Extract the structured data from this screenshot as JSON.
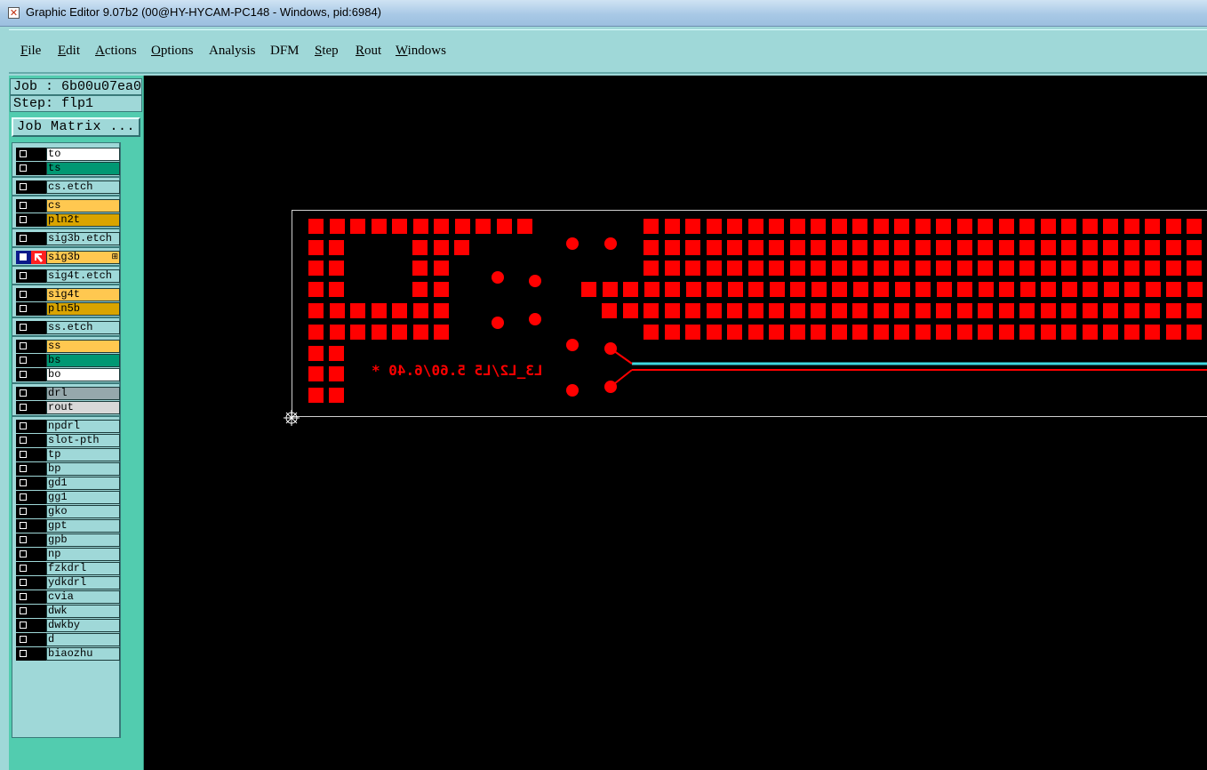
{
  "window": {
    "title": "Graphic Editor 9.07b2 (00@HY-HYCAM-PC148 - Windows, pid:6984)"
  },
  "menu": [
    {
      "pre": "",
      "ul": "F",
      "post": "ile"
    },
    {
      "pre": "",
      "ul": "E",
      "post": "dit"
    },
    {
      "pre": "",
      "ul": "A",
      "post": "ctions"
    },
    {
      "pre": "",
      "ul": "O",
      "post": "ptions"
    },
    {
      "pre": "",
      "ul": "",
      "post": "Analysis"
    },
    {
      "pre": "",
      "ul": "",
      "post": "DFM"
    },
    {
      "pre": "",
      "ul": "S",
      "post": "tep"
    },
    {
      "pre": "",
      "ul": "R",
      "post": "out"
    },
    {
      "pre": "",
      "ul": "W",
      "post": "indows"
    }
  ],
  "side": {
    "job": "Job : 6b00u07ea0",
    "step": "Step: flp1",
    "job_matrix": "Job Matrix ..."
  },
  "layers": [
    {
      "name": "to",
      "color": "#ffffff"
    },
    {
      "name": "ts",
      "color": "#009873"
    },
    {
      "name": "cs.etch",
      "color": "#9fd8d8"
    },
    {
      "name": "cs",
      "color": "#ffc850"
    },
    {
      "name": "pln2t",
      "color": "#d9a400"
    },
    {
      "name": "sig3b.etch",
      "color": "#9fd8d8"
    },
    {
      "name": "sig3b",
      "color": "#ffc850",
      "active": true
    },
    {
      "name": "sig4t.etch",
      "color": "#9fd8d8"
    },
    {
      "name": "sig4t",
      "color": "#ffc850"
    },
    {
      "name": "pln5b",
      "color": "#d9a400"
    },
    {
      "name": "ss.etch",
      "color": "#9fd8d8"
    },
    {
      "name": "ss",
      "color": "#ffc850"
    },
    {
      "name": "bs",
      "color": "#009873"
    },
    {
      "name": "bo",
      "color": "#ffffff"
    },
    {
      "name": "drl",
      "color": "#96a8ac"
    },
    {
      "name": "rout",
      "color": "#d8d8d8"
    },
    {
      "name": "npdrl",
      "color": "#9fd8d8"
    },
    {
      "name": "slot-pth",
      "color": "#9fd8d8"
    },
    {
      "name": "tp",
      "color": "#9fd8d8"
    },
    {
      "name": "bp",
      "color": "#9fd8d8"
    },
    {
      "name": "gd1",
      "color": "#9fd8d8"
    },
    {
      "name": "gg1",
      "color": "#9fd8d8"
    },
    {
      "name": "gko",
      "color": "#9fd8d8"
    },
    {
      "name": "gpt",
      "color": "#9fd8d8"
    },
    {
      "name": "gpb",
      "color": "#9fd8d8"
    },
    {
      "name": "np",
      "color": "#9fd8d8"
    },
    {
      "name": "fzkdrl",
      "color": "#9fd8d8"
    },
    {
      "name": "ydkdrl",
      "color": "#9fd8d8"
    },
    {
      "name": "cvia",
      "color": "#9fd8d8"
    },
    {
      "name": "dwk",
      "color": "#9fd8d8"
    },
    {
      "name": "dwkby",
      "color": "#9fd8d8"
    },
    {
      "name": "d",
      "color": "#9fd8d8"
    },
    {
      "name": "biaozhu",
      "color": "#9fd8d8"
    }
  ],
  "canvas": {
    "feature_color": "#ff0000",
    "trace_color": "#40d8e0",
    "mirrored_text": "L3_L2/L5 5.60/6.40 *"
  }
}
